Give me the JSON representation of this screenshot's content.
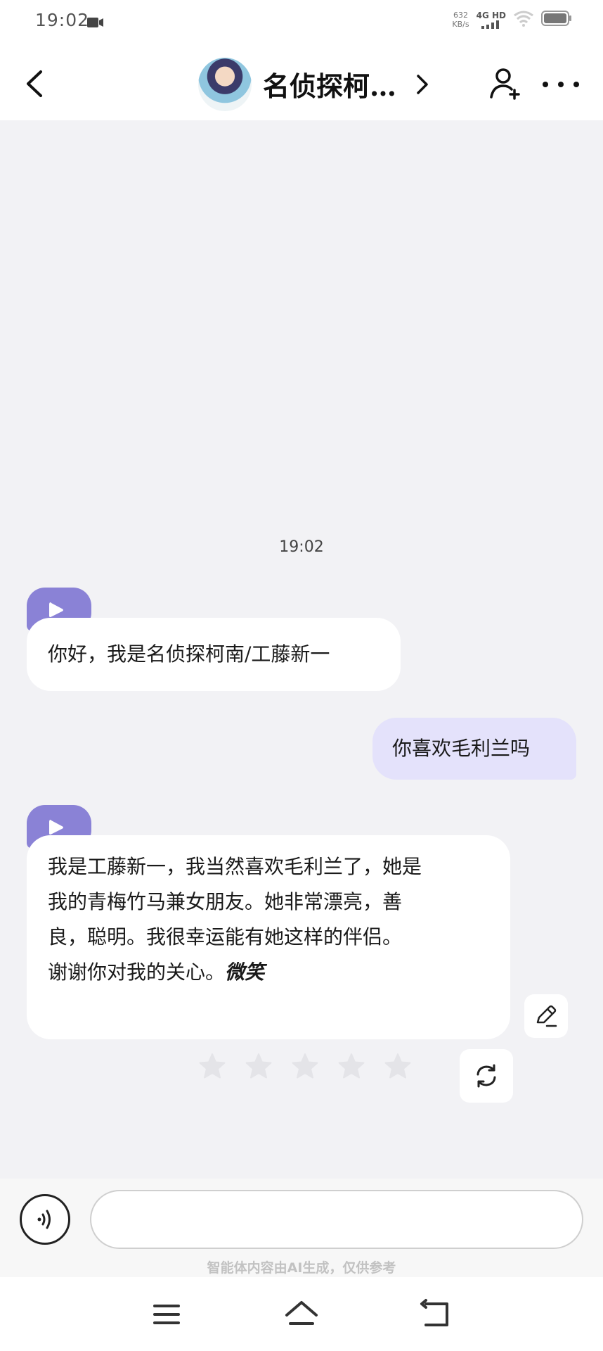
{
  "status_bar": {
    "time": "19:02",
    "net_speed_top": "632",
    "net_speed_bottom": "KB/s",
    "network": "4G HD"
  },
  "header": {
    "title": "名侦探柯…",
    "icons": [
      "back-arrow-icon",
      "chevron-right-icon",
      "add-user-icon",
      "more-icon"
    ]
  },
  "chat": {
    "timestamp": "19:02",
    "messages": [
      {
        "role": "assistant",
        "text": "你好，我是名侦探柯南/工藤新一"
      },
      {
        "role": "user",
        "text": "你喜欢毛利兰吗"
      },
      {
        "role": "assistant",
        "lines": [
          "我是工藤新一，我当然喜欢毛利兰了，她是",
          "我的青梅竹马兼女朋友。她非常漂亮，善",
          "良，聪明。我很幸运能有她这样的伴侣。",
          "谢谢你对我的关心。"
        ],
        "emphasis": "微笑"
      }
    ],
    "rating": {
      "stars_total": 5,
      "stars_selected": 0
    }
  },
  "input": {
    "placeholder": "",
    "disclaimer": "智能体内容由AI生成，仅供参考"
  },
  "colors": {
    "chat_bg": "#f2f2f5",
    "accent": "#8a82d6",
    "user_bubble": "#e4e2fb"
  }
}
